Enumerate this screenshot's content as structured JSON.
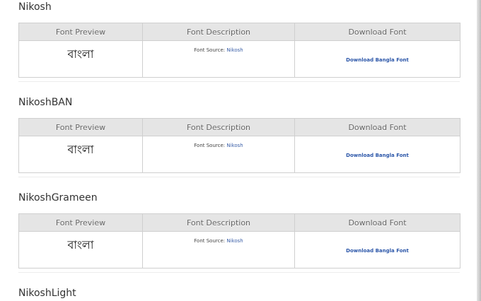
{
  "headers": {
    "preview": "Font Preview",
    "description": "Font Description",
    "download": "Download Font"
  },
  "fonts": [
    {
      "name": "Nikosh",
      "preview_text": "বাংলা",
      "source_label": "Font Source:",
      "source_link": "Nikosh",
      "download_label": "Download Bangla Font"
    },
    {
      "name": "NikoshBAN",
      "preview_text": "বাংলা",
      "source_label": "Font Source:",
      "source_link": "Nikosh",
      "download_label": "Download Bangla Font"
    },
    {
      "name": "NikoshGrameen",
      "preview_text": "বাংলা",
      "source_label": "Font Source:",
      "source_link": "Nikosh",
      "download_label": "Download Bangla Font"
    },
    {
      "name": "NikoshLight"
    }
  ]
}
